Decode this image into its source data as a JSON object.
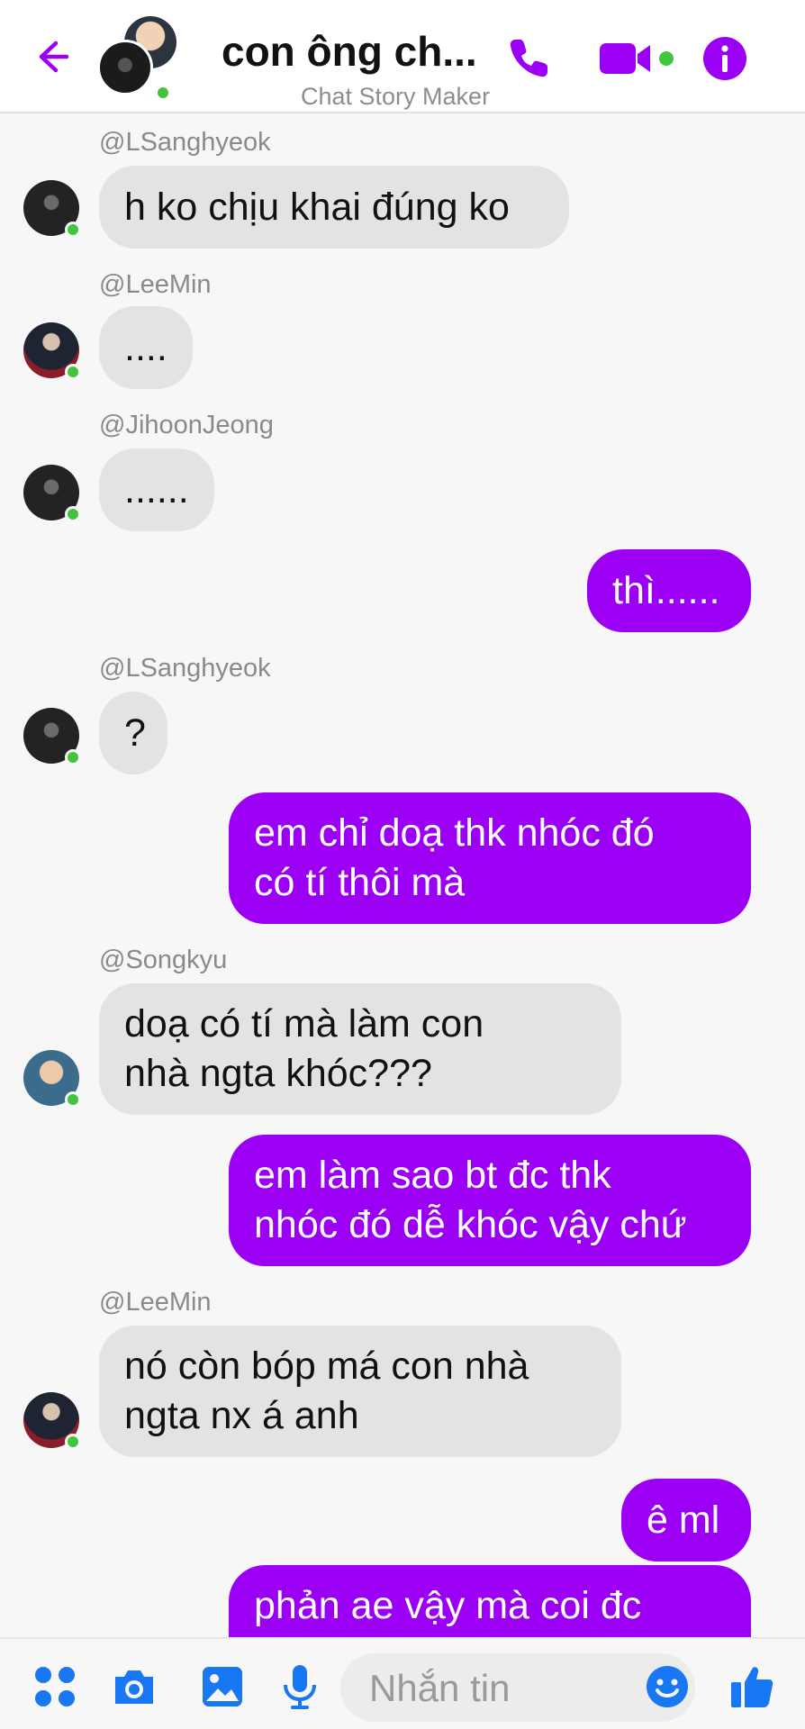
{
  "header": {
    "title": "con ông ch...",
    "subtitle": "Chat Story Maker"
  },
  "messages": [
    {
      "sender": "@LSanghyeok",
      "text": "h ko chịu khai đúng ko"
    },
    {
      "sender": "@LeeMin",
      "text": "...."
    },
    {
      "sender": "@JihoonJeong",
      "text": "......"
    },
    {
      "text": "thì......"
    },
    {
      "sender": "@LSanghyeok",
      "text": "?"
    },
    {
      "text": "em chỉ doạ thk nhóc đó\ncó tí thôi mà"
    },
    {
      "sender": "@Songkyu",
      "text": "doạ có tí mà làm con\nnhà ngta khóc???"
    },
    {
      "text": "em làm sao bt đc thk\nnhóc đó dễ khóc vậy chứ"
    },
    {
      "sender": "@LeeMin",
      "text": "nó còn bóp má con nhà\nngta nx á anh"
    },
    {
      "text": "ê ml"
    },
    {
      "text": "phản ae vậy mà coi đc"
    }
  ],
  "composer": {
    "placeholder": "Nhắn tin"
  },
  "colors": {
    "accent": "#9b00f5",
    "incoming_bubble": "#e3e3e3",
    "online": "#42c43c"
  }
}
